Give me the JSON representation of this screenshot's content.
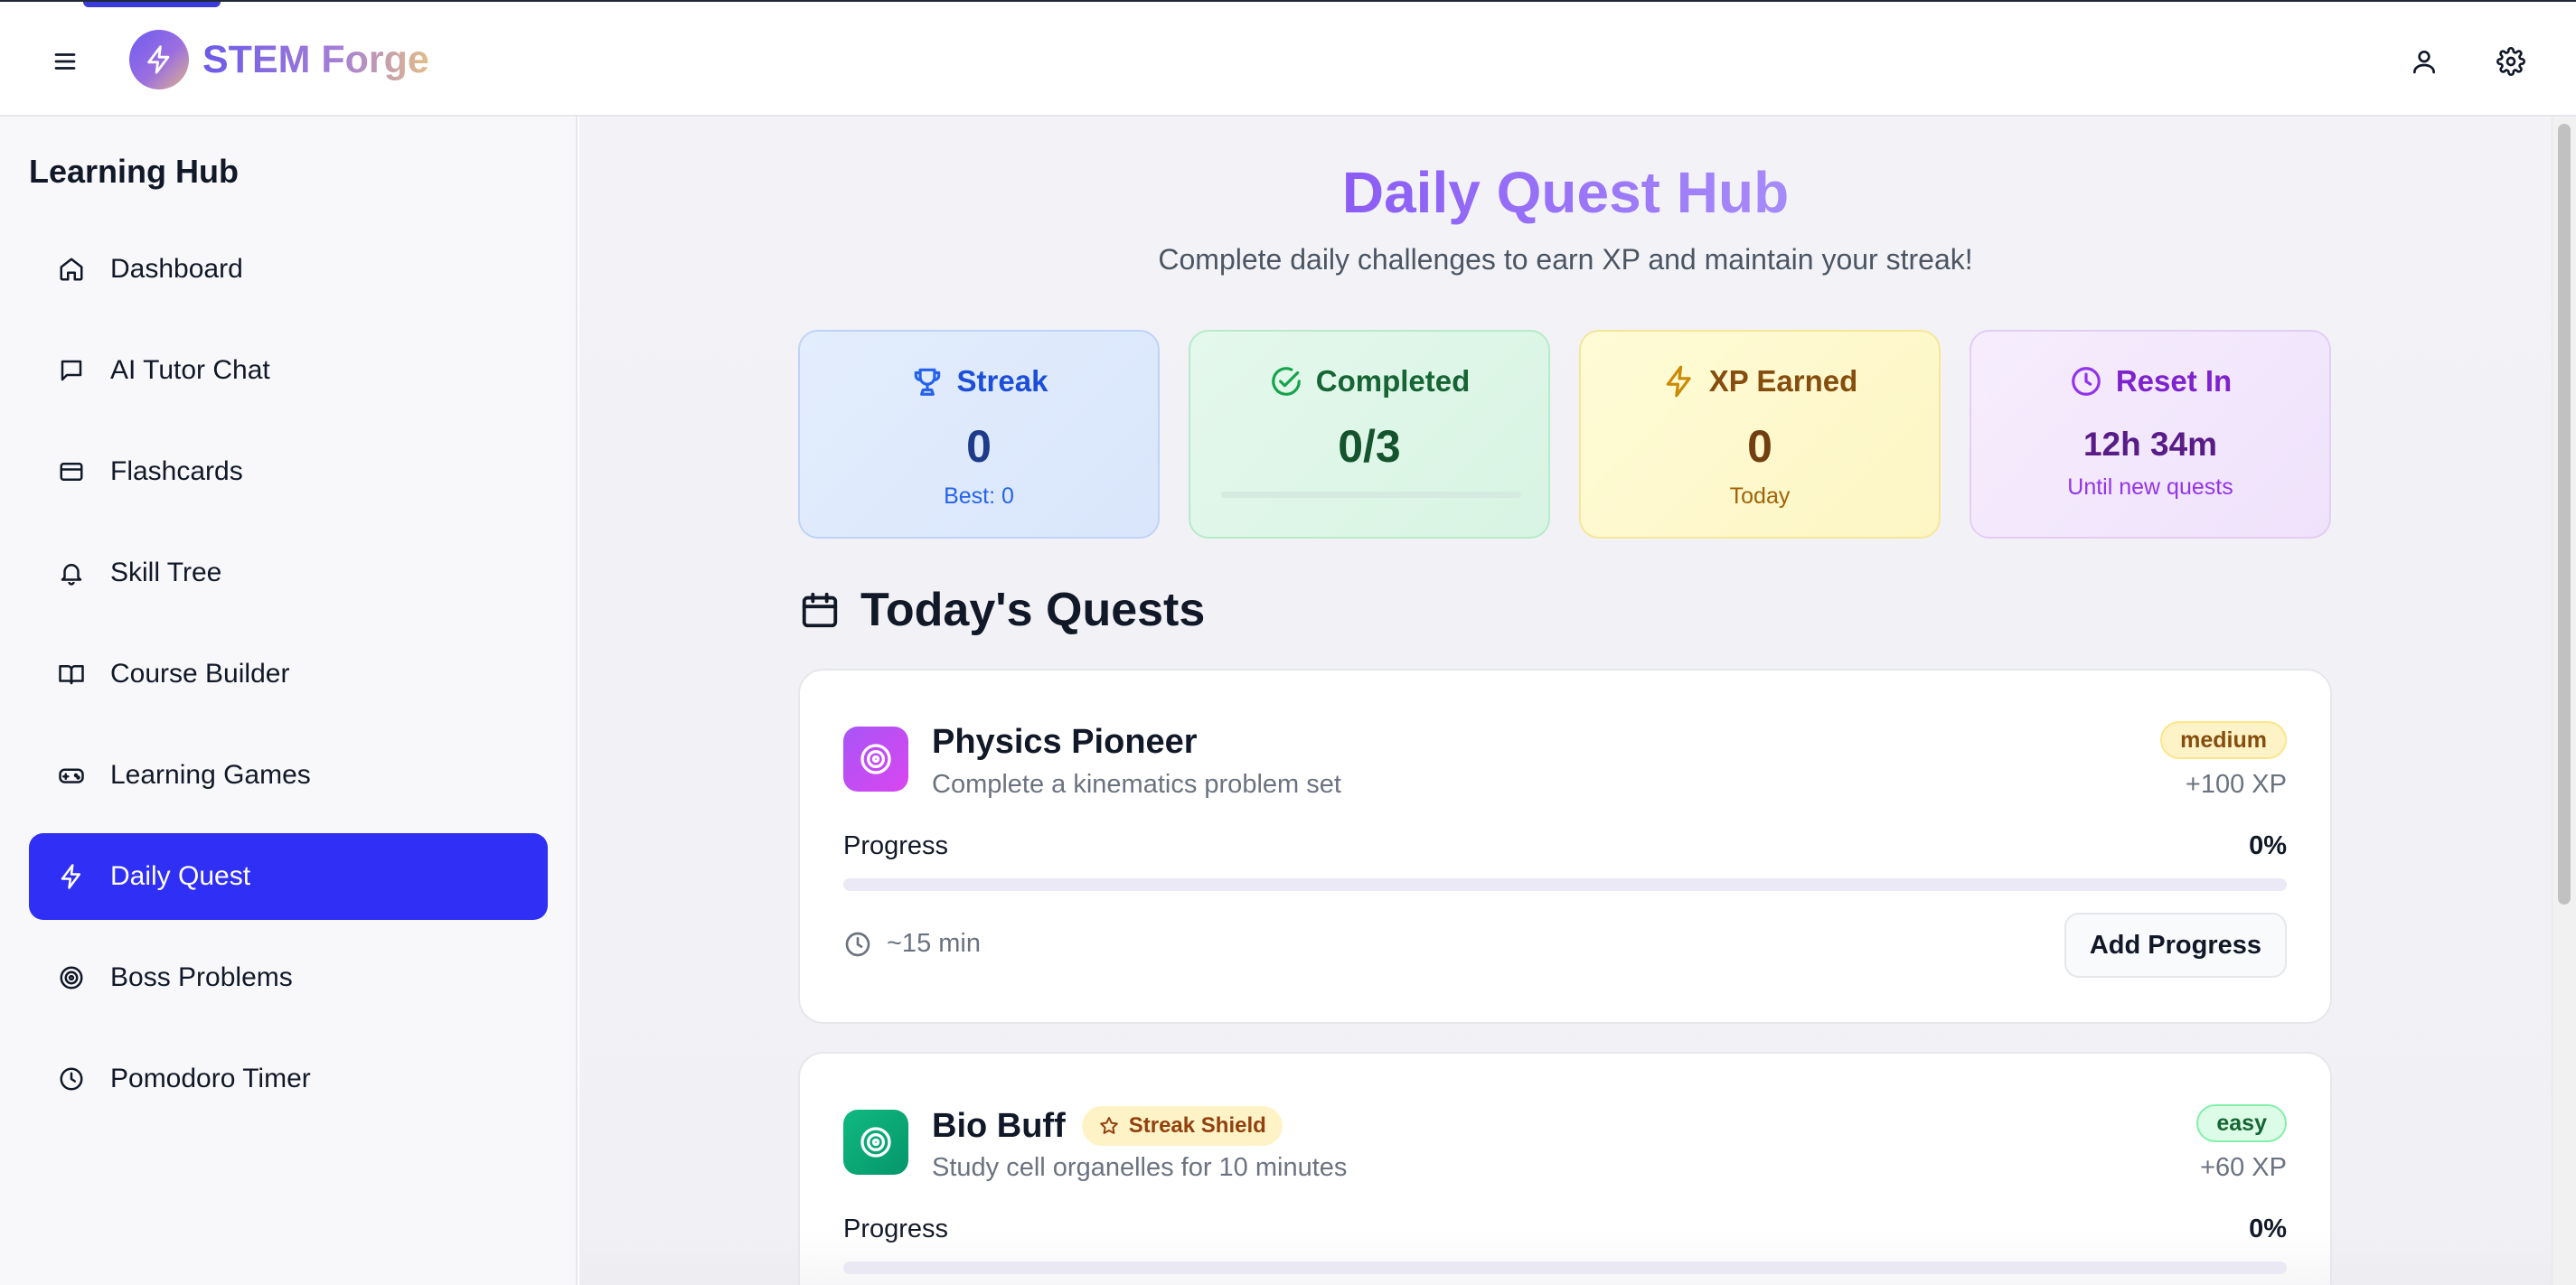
{
  "app": {
    "name": "STEM Forge"
  },
  "sidebar": {
    "title": "Learning Hub",
    "items": [
      {
        "label": "Dashboard",
        "icon": "home-icon"
      },
      {
        "label": "AI Tutor Chat",
        "icon": "chat-icon"
      },
      {
        "label": "Flashcards",
        "icon": "card-icon"
      },
      {
        "label": "Skill Tree",
        "icon": "bell-icon"
      },
      {
        "label": "Course Builder",
        "icon": "book-icon"
      },
      {
        "label": "Learning Games",
        "icon": "gamepad-icon"
      },
      {
        "label": "Daily Quest",
        "icon": "lightning-icon",
        "active": true
      },
      {
        "label": "Boss Problems",
        "icon": "target-icon"
      },
      {
        "label": "Pomodoro Timer",
        "icon": "clock-icon"
      }
    ]
  },
  "header": {
    "title": "Daily Quest Hub",
    "subtitle": "Complete daily challenges to earn XP and maintain your streak!"
  },
  "stats": {
    "streak": {
      "label": "Streak",
      "value": "0",
      "note": "Best: 0",
      "color": "#1d4ed8"
    },
    "completed": {
      "label": "Completed",
      "value": "0/3",
      "progress": 0,
      "color": "#15803d"
    },
    "xp": {
      "label": "XP Earned",
      "value": "0",
      "note": "Today",
      "color": "#a16207"
    },
    "reset": {
      "label": "Reset In",
      "value": "12h 34m",
      "note": "Until new quests",
      "color": "#7e22ce"
    }
  },
  "quests_section": {
    "title": "Today's Quests"
  },
  "quests": [
    {
      "title": "Physics Pioneer",
      "description": "Complete a kinematics problem set",
      "difficulty": "medium",
      "xp": "+100 XP",
      "progress_label": "Progress",
      "progress_pct": "0%",
      "progress": 0,
      "time": "~15 min",
      "action": "Add Progress",
      "color": "#a855f7"
    },
    {
      "title": "Bio Buff",
      "badge": "Streak Shield",
      "description": "Study cell organelles for 10 minutes",
      "difficulty": "easy",
      "xp": "+60 XP",
      "progress_label": "Progress",
      "progress_pct": "0%",
      "progress": 0,
      "color": "#10b981"
    }
  ]
}
